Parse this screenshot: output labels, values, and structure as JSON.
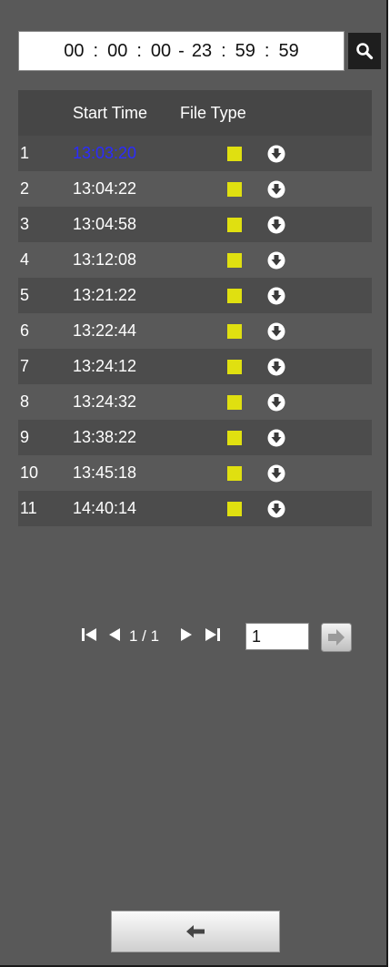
{
  "search": {
    "start": {
      "h": "00",
      "m": "00",
      "s": "00"
    },
    "end": {
      "h": "23",
      "m": "59",
      "s": "59"
    },
    "separator": "-",
    "colon": ":"
  },
  "table": {
    "columns": {
      "start_time": "Start Time",
      "file_type": "File Type"
    },
    "rows": [
      {
        "index": "1",
        "time": "13:03:20"
      },
      {
        "index": "2",
        "time": "13:04:22"
      },
      {
        "index": "3",
        "time": "13:04:58"
      },
      {
        "index": "4",
        "time": "13:12:08"
      },
      {
        "index": "5",
        "time": "13:21:22"
      },
      {
        "index": "6",
        "time": "13:22:44"
      },
      {
        "index": "7",
        "time": "13:24:12"
      },
      {
        "index": "8",
        "time": "13:24:32"
      },
      {
        "index": "9",
        "time": "13:38:22"
      },
      {
        "index": "10",
        "time": "13:45:18"
      },
      {
        "index": "11",
        "time": "14:40:14"
      }
    ],
    "selected_color": "#2b2bff",
    "file_type_color": "#e0e010"
  },
  "pager": {
    "page_info": "1 / 1",
    "page_input": "1"
  },
  "icons": {
    "search": "search-icon",
    "download": "download-icon",
    "first": "first-page-icon",
    "prev": "prev-page-icon",
    "next": "next-page-icon",
    "last": "last-page-icon",
    "go": "go-arrow-icon",
    "back": "back-arrow-icon"
  }
}
